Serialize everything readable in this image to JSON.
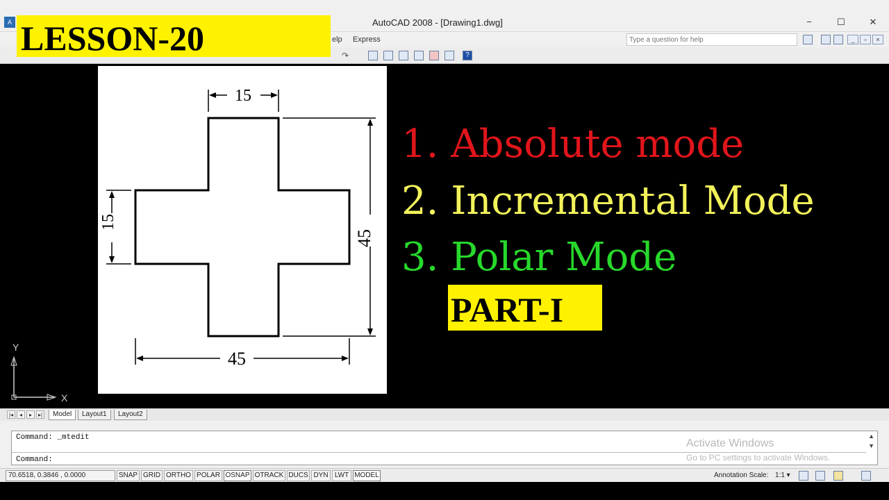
{
  "window": {
    "title": "AutoCAD 2008 - [Drawing1.dwg]",
    "minimize": "−",
    "maximize": "☐",
    "close": "✕"
  },
  "menu": {
    "items": [
      "elp",
      "Express"
    ],
    "help_placeholder": "Type a question for help"
  },
  "banner": {
    "lesson": "LESSON-20"
  },
  "figure": {
    "dim_top": "15",
    "dim_left": "15",
    "dim_right": "45",
    "dim_bottom": "45"
  },
  "modes": {
    "line1": "1. Absolute mode",
    "line2": "2. Incremental  Mode",
    "line3": "3. Polar Mode",
    "part": "PART-I"
  },
  "ucs": {
    "x_label": "X",
    "y_label": "Y"
  },
  "tabs": {
    "items": [
      "Model",
      "Layout1",
      "Layout2"
    ]
  },
  "command": {
    "line1": "Command:  _mtedit",
    "line2": "Command:"
  },
  "activation": {
    "title": "Activate Windows",
    "subtitle": "Go to PC settings to activate Windows."
  },
  "status": {
    "coords": "70.6518, 0.3846 , 0.0000",
    "buttons": [
      "SNAP",
      "GRID",
      "ORTHO",
      "POLAR",
      "OSNAP",
      "OTRACK",
      "DUCS",
      "DYN",
      "LWT",
      "MODEL"
    ],
    "annotation_label": "Annotation Scale:",
    "annotation_value": "1:1 ▾"
  },
  "colors": {
    "mode1": "#e0151b",
    "mode2": "#f2f25a",
    "mode3": "#27d82b",
    "highlight": "#fff200"
  }
}
